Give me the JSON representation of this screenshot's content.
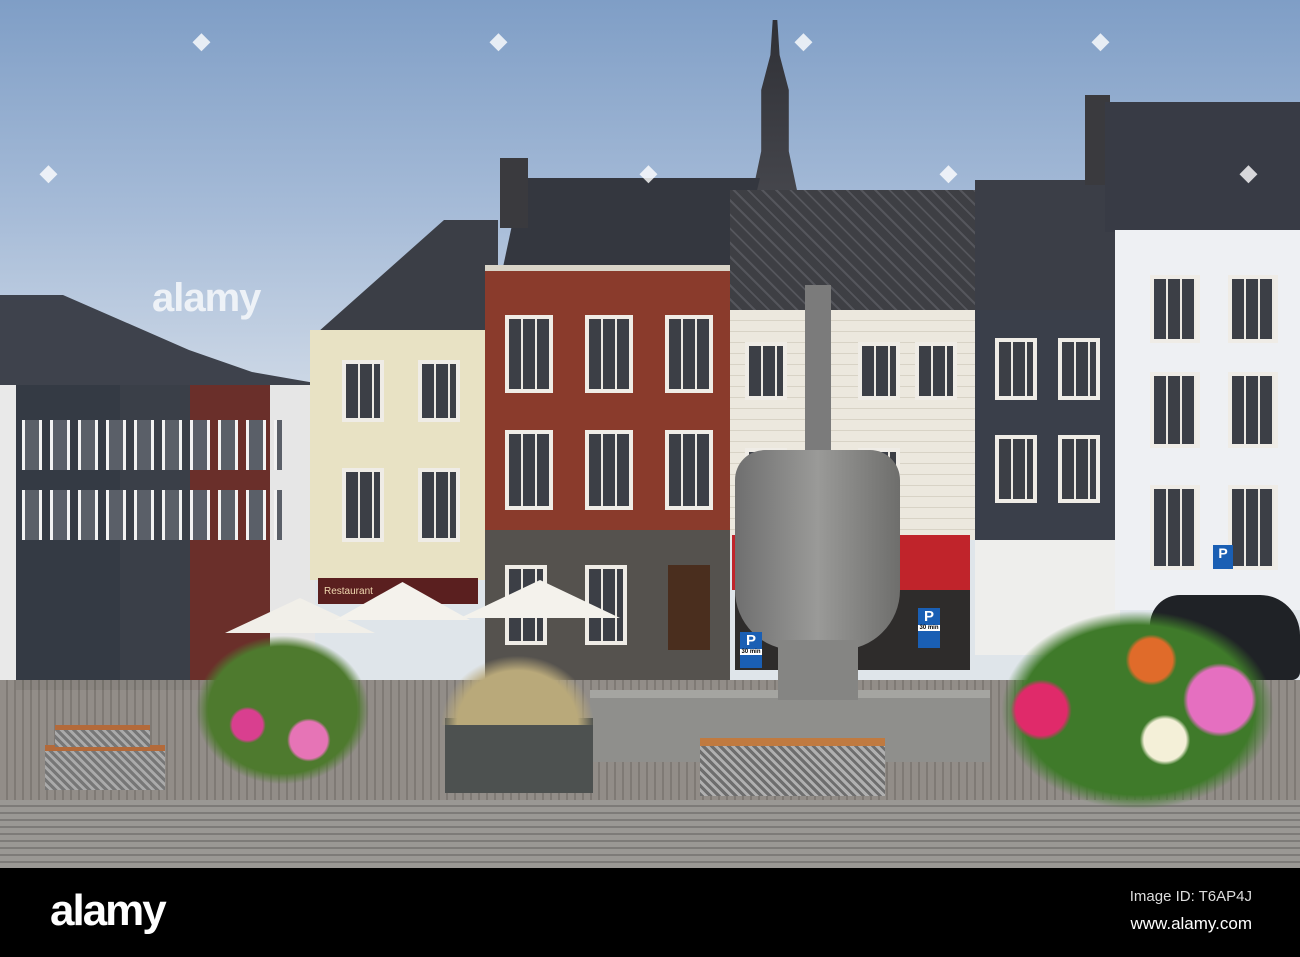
{
  "watermark": {
    "logo": "alamy",
    "center_text": "alamy",
    "image_id": "Image ID: T6AP4J",
    "url": "www.alamy.com"
  },
  "signs": {
    "restaurant": "Restaurant",
    "parking_1": "P",
    "parking_1_sub": "30 min",
    "parking_2": "P",
    "parking_2_sub": "30 min",
    "parking_3": "P"
  },
  "colors": {
    "sky": "#a7bcd8",
    "slate": "#3a3e48",
    "brick": "#8a3b2c",
    "cream": "#e8e2c4",
    "awning": "#c0242b",
    "cobble": "#8b8680",
    "footer": "#000000"
  }
}
